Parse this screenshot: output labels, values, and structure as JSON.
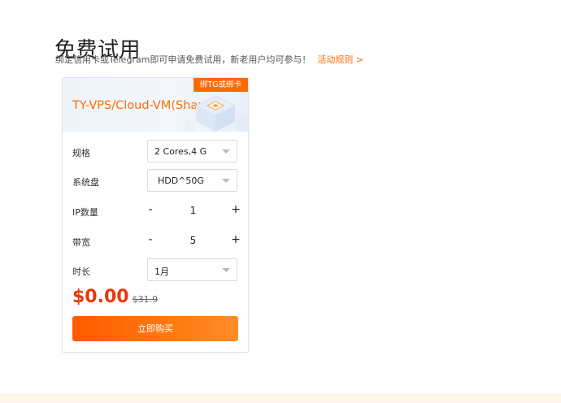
{
  "header": {
    "title": "免费试用",
    "subtitle": "绑定信用卡或Telegram即可申请免费试用，新老用户均可参与！",
    "rules_link": "活动规则 >"
  },
  "card": {
    "badge": "绑TG或绑卡",
    "plan_name": "TY-VPS/Cloud-VM(Shared)",
    "spec": {
      "label": "规格",
      "value": "2 Cores,4 G"
    },
    "disk": {
      "label": "系统盘",
      "value": "HDD^50G"
    },
    "ip": {
      "label": "IP数量",
      "minus": "-",
      "value": "1",
      "plus": "+"
    },
    "bandwidth": {
      "label": "带宽",
      "minus": "-",
      "value": "5",
      "plus": "+"
    },
    "duration": {
      "label": "时长",
      "value": "1月"
    },
    "price": {
      "current": "$0.00",
      "original": "$31.9"
    },
    "buy_label": "立即购买"
  },
  "colors": {
    "accent": "#ff6a00",
    "price_red": "#e8380d",
    "bottom_band": "#fdf4ec"
  }
}
